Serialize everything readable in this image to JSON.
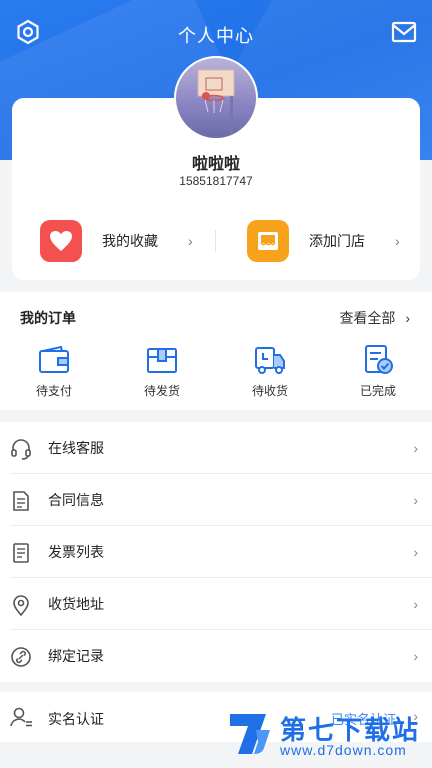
{
  "header": {
    "title": "个人中心",
    "left_icon": "settings-hexagon-icon",
    "right_icon": "mail-icon"
  },
  "profile": {
    "username": "啦啦啦",
    "phone": "15851817747",
    "avatar": "basketball-hoop-avatar"
  },
  "quick_actions": [
    {
      "label": "我的收藏",
      "icon": "heart-icon",
      "color": "#f4504f"
    },
    {
      "label": "添加门店",
      "icon": "store-icon",
      "color": "#f7a21b"
    }
  ],
  "orders": {
    "title": "我的订单",
    "view_all": "查看全部",
    "items": [
      {
        "label": "待支付",
        "icon": "wallet-icon"
      },
      {
        "label": "待发货",
        "icon": "package-icon"
      },
      {
        "label": "待收货",
        "icon": "truck-icon"
      },
      {
        "label": "已完成",
        "icon": "completed-doc-icon"
      }
    ]
  },
  "menu": [
    {
      "label": "在线客服",
      "icon": "headset-icon"
    },
    {
      "label": "合同信息",
      "icon": "document-icon"
    },
    {
      "label": "发票列表",
      "icon": "invoice-icon"
    },
    {
      "label": "收货地址",
      "icon": "location-pin-icon"
    },
    {
      "label": "绑定记录",
      "icon": "link-icon"
    }
  ],
  "verification": {
    "label": "实名认证",
    "status": "已实名认证",
    "icon": "user-verify-icon"
  },
  "watermark": {
    "name": "第七下载站",
    "url": "www.d7down.com"
  },
  "colors": {
    "primary": "#1f6fe6",
    "heart": "#f4504f",
    "store": "#f7a21b",
    "status_blue": "#3b82f6"
  }
}
